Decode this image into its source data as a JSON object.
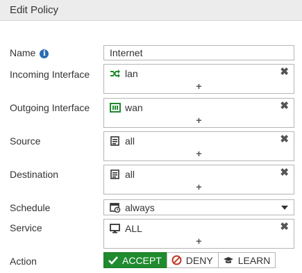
{
  "header": {
    "title": "Edit Policy"
  },
  "colors": {
    "accent_green": "#1f8a2e",
    "deny_red": "#c0392b",
    "interface_green": "#1f8a2e",
    "info_blue": "#2b6cb0"
  },
  "form": {
    "name": {
      "label": "Name",
      "value": "Internet",
      "icon": "info-icon"
    },
    "incoming": {
      "label": "Incoming Interface",
      "entry": "lan",
      "icon": "shuffle-icon",
      "add": "+",
      "remove": "✖"
    },
    "outgoing": {
      "label": "Outgoing Interface",
      "entry": "wan",
      "icon": "port-icon",
      "add": "+",
      "remove": "✖"
    },
    "source": {
      "label": "Source",
      "entry": "all",
      "icon": "address-list-icon",
      "add": "+",
      "remove": "✖"
    },
    "destination": {
      "label": "Destination",
      "entry": "all",
      "icon": "address-list-icon",
      "add": "+",
      "remove": "✖"
    },
    "schedule": {
      "label": "Schedule",
      "value": "always",
      "icon": "calendar-clock-icon"
    },
    "service": {
      "label": "Service",
      "entry": "ALL",
      "icon": "monitor-icon",
      "add": "+",
      "remove": "✖"
    },
    "action": {
      "label": "Action",
      "options": [
        {
          "label": "ACCEPT",
          "icon": "check-icon",
          "selected": true
        },
        {
          "label": "DENY",
          "icon": "ban-icon",
          "selected": false
        },
        {
          "label": "LEARN",
          "icon": "graduation-cap-icon",
          "selected": false
        }
      ]
    }
  }
}
